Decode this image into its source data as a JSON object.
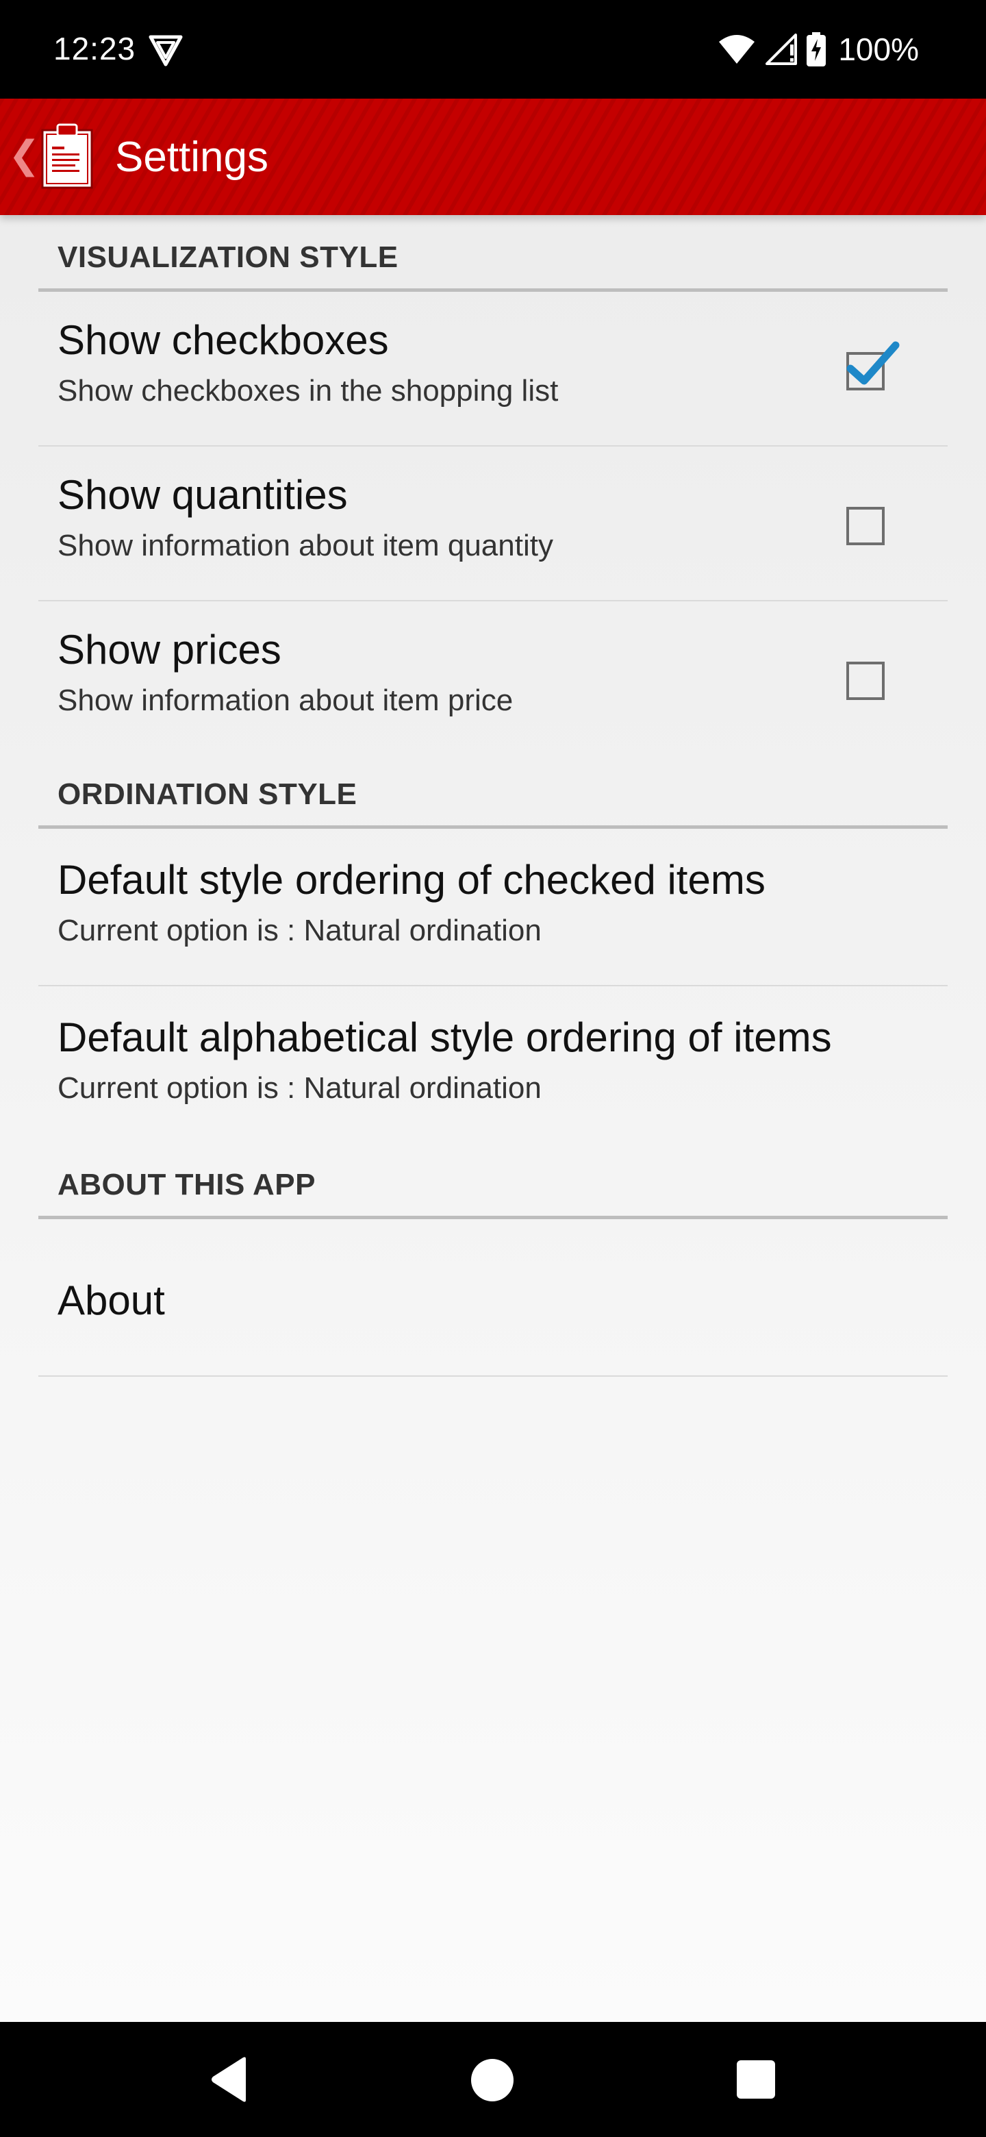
{
  "status_bar": {
    "time": "12:23",
    "battery": "100%",
    "icons": [
      "vpn-shield-icon",
      "wifi-icon",
      "cellular-signal-icon",
      "battery-charging-icon"
    ]
  },
  "app_bar": {
    "title": "Settings",
    "icons": [
      "back-chevron-icon",
      "clipboard-app-icon"
    ],
    "color": "#c40000"
  },
  "sections": [
    {
      "header": "VISUALIZATION STYLE",
      "items": [
        {
          "title": "Show checkboxes",
          "summary": "Show checkboxes in the shopping list",
          "checked": true
        },
        {
          "title": "Show quantities",
          "summary": "Show information about item quantity",
          "checked": false
        },
        {
          "title": "Show prices",
          "summary": "Show information about item price",
          "checked": false
        }
      ]
    },
    {
      "header": "ORDINATION STYLE",
      "items": [
        {
          "title": "Default style ordering of checked items",
          "summary": "Current option is : Natural ordination"
        },
        {
          "title": "Default alphabetical style ordering of items",
          "summary": "Current option is : Natural ordination"
        }
      ]
    },
    {
      "header": "ABOUT THIS APP",
      "items": [
        {
          "title": "About"
        }
      ]
    }
  ],
  "accent_color": "#1e88c8",
  "nav_bar": {
    "icons": [
      "back-triangle-icon",
      "home-circle-icon",
      "recents-square-icon"
    ]
  }
}
